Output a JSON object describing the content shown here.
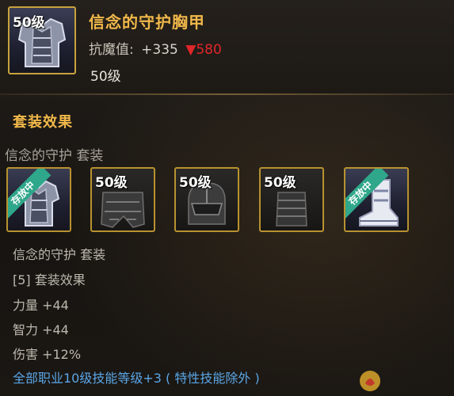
{
  "item": {
    "level_tag": "50级",
    "name": "信念的守护胸甲",
    "stat_label": "抗魔值:",
    "stat_value": "+335",
    "compare_arrow": "▼",
    "compare_value": "580",
    "level": "50级"
  },
  "set": {
    "section_title": "套装效果",
    "heading": "信念的守护  套装",
    "slots": [
      {
        "label": "存放中",
        "icon": "chest-armor-icon",
        "owned": true
      },
      {
        "label": "50级",
        "icon": "pants-armor-icon",
        "owned": false
      },
      {
        "label": "50级",
        "icon": "helmet-icon",
        "owned": false
      },
      {
        "label": "50级",
        "icon": "arm-guard-icon",
        "owned": false
      },
      {
        "label": "存放中",
        "icon": "boots-icon",
        "owned": true
      }
    ],
    "info_lines": [
      "信念的守护  套装",
      "[5] 套装效果",
      "力量 +44",
      "智力 +44",
      "伤害 +12%",
      "全部职业10级技能等级+3 ( 特性技能除外 )"
    ]
  },
  "colors": {
    "gold": "#f0b84a",
    "red": "#e0262a",
    "blue": "#5aa6e6",
    "teal": "#2fa78a"
  }
}
